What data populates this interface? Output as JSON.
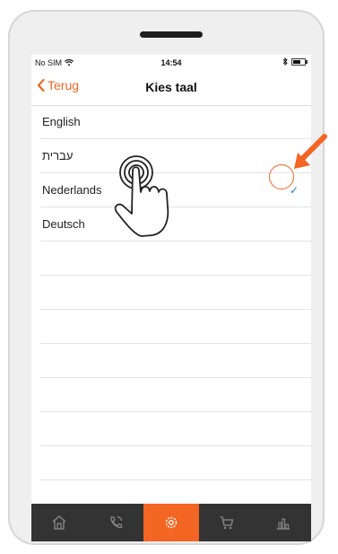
{
  "status_bar": {
    "carrier": "No SIM",
    "time": "14:54",
    "bluetooth_icon": "bluetooth-icon",
    "battery_icon": "battery-icon"
  },
  "nav": {
    "back_label": "Terug",
    "title": "Kies taal"
  },
  "languages": [
    {
      "label": "English",
      "selected": false
    },
    {
      "label": "עברית",
      "selected": false
    },
    {
      "label": "Nederlands",
      "selected": true
    },
    {
      "label": "Deutsch",
      "selected": false
    }
  ],
  "checkmark": "✓",
  "tabbar": {
    "tabs": [
      {
        "icon": "home-icon",
        "active": false
      },
      {
        "icon": "phone-icon",
        "active": false
      },
      {
        "icon": "settings-icon",
        "active": true
      },
      {
        "icon": "cart-icon",
        "active": false
      },
      {
        "icon": "chart-icon",
        "active": false
      }
    ]
  },
  "colors": {
    "accent": "#f26522",
    "tabbar_bg": "#333333",
    "check": "#2a7bd6"
  }
}
